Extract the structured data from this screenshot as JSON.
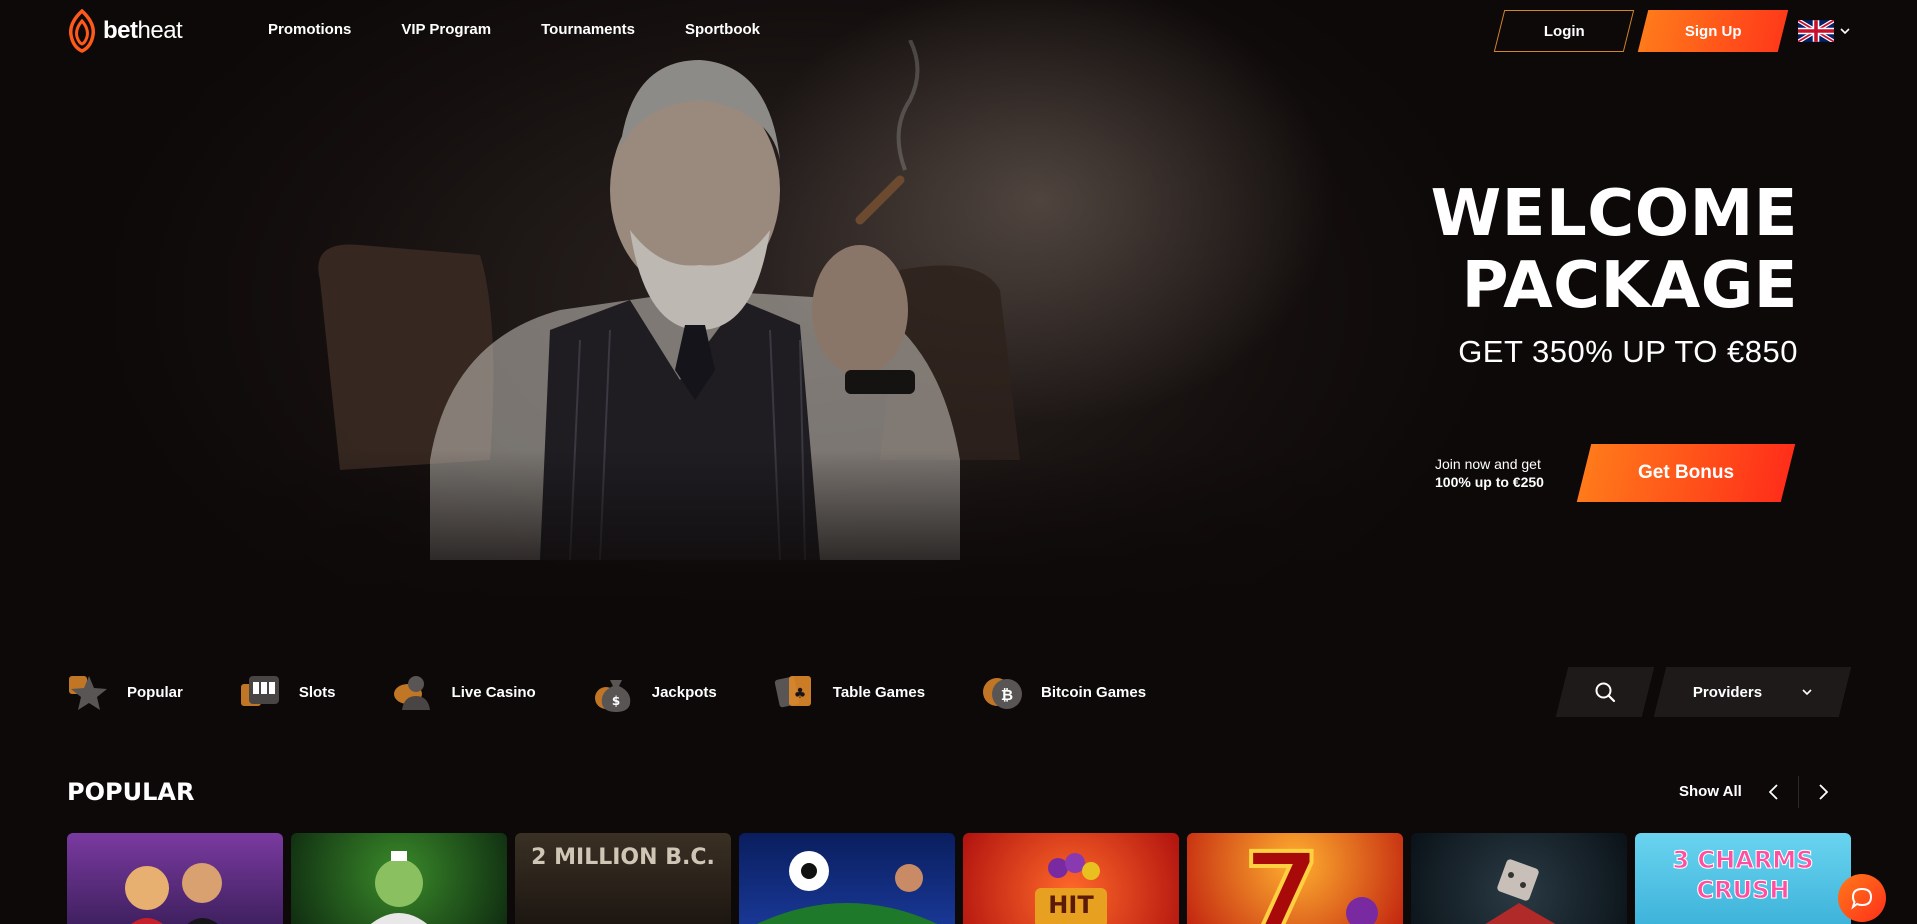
{
  "header": {
    "logo_text_bold": "bet",
    "logo_text_light": "heat",
    "nav": [
      "Promotions",
      "VIP Program",
      "Tournaments",
      "Sportbook"
    ],
    "login_label": "Login",
    "signup_label": "Sign Up",
    "language_icon": "uk-flag-icon"
  },
  "hero": {
    "title_line1": "WELCOME",
    "title_line2": "PACKAGE",
    "subtitle": "GET 350% UP TO €850",
    "join_line1": "Join now and get",
    "join_line2": "100% up to €250",
    "cta_label": "Get Bonus"
  },
  "categories": [
    {
      "label": "Popular",
      "icon": "star-icon"
    },
    {
      "label": "Slots",
      "icon": "slot-machine-icon"
    },
    {
      "label": "Live Casino",
      "icon": "dealer-icon"
    },
    {
      "label": "Jackpots",
      "icon": "money-bag-icon"
    },
    {
      "label": "Table Games",
      "icon": "cards-icon"
    },
    {
      "label": "Bitcoin Games",
      "icon": "bitcoin-icon"
    }
  ],
  "filters": {
    "providers_label": "Providers"
  },
  "popular": {
    "title": "POPULAR",
    "show_all": "Show All",
    "games": [
      {
        "label": "",
        "bg": "#5a2e7a"
      },
      {
        "label": "",
        "bg": "#1d4a1d"
      },
      {
        "label": "2 MILLION B.C.",
        "bg": "#2a2218"
      },
      {
        "label": "",
        "bg": "#0e2a6e"
      },
      {
        "label": "HIT",
        "bg": "#d8281c"
      },
      {
        "label": "",
        "bg": "#d9301a"
      },
      {
        "label": "",
        "bg": "#142028"
      },
      {
        "label": "3 CHARMS CRUSH",
        "bg": "#5cc8e8"
      }
    ]
  },
  "colors": {
    "accent": "#ff6a1a",
    "accent_end": "#ff2e1a",
    "background": "#0d0909",
    "panel": "#1e1a1a"
  }
}
